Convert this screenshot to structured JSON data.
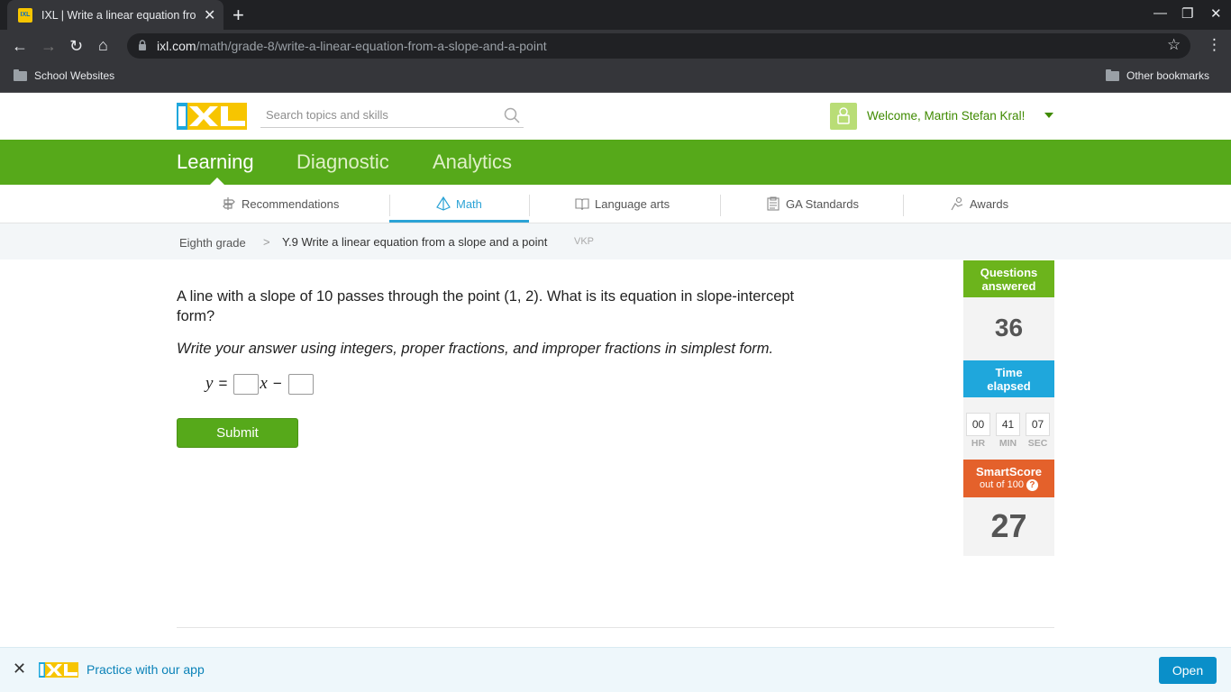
{
  "browser": {
    "tab_title": "IXL | Write a linear equation from",
    "favicon_text": "IXL",
    "url_domain": "ixl.com",
    "url_path": "/math/grade-8/write-a-linear-equation-from-a-slope-and-a-point",
    "bookmarks": {
      "left": "School Websites",
      "right": "Other bookmarks"
    }
  },
  "header": {
    "search_placeholder": "Search topics and skills",
    "welcome": "Welcome, Martin Stefan Kral!"
  },
  "main_nav": {
    "items": [
      "Learning",
      "Diagnostic",
      "Analytics"
    ],
    "active": "Learning"
  },
  "sub_nav": {
    "items": [
      "Recommendations",
      "Math",
      "Language arts",
      "GA Standards",
      "Awards"
    ],
    "active": "Math"
  },
  "breadcrumb": {
    "grade": "Eighth grade",
    "separator": ">",
    "skill": "Y.9 Write a linear equation from a slope and a point",
    "code": "VKP"
  },
  "question": {
    "prompt": "A line with a slope of 10 passes through the point (1, 2). What is its equation in slope-intercept form?",
    "instruction": "Write your answer using integers, proper fractions, and improper fractions in simplest form.",
    "eq_y": "y",
    "eq_equals": "=",
    "eq_x": "x",
    "eq_minus": "−",
    "submit_label": "Submit"
  },
  "stats": {
    "questions_label_1": "Questions",
    "questions_label_2": "answered",
    "questions_answered": "36",
    "time_label_1": "Time",
    "time_label_2": "elapsed",
    "time": {
      "hr": "00",
      "min": "41",
      "sec": "07"
    },
    "time_units": {
      "hr": "HR",
      "min": "MIN",
      "sec": "SEC"
    },
    "smartscore_label": "SmartScore",
    "smartscore_sub": "out of 100",
    "smartscore_help": "?",
    "smartscore": "27"
  },
  "app_banner": {
    "text": "Practice with our app",
    "open_label": "Open"
  },
  "colors": {
    "ixl_green": "#56a91a",
    "ixl_blue": "#2ba3d6",
    "smartscore_orange": "#e4612b",
    "questions_green": "#6cb41c",
    "time_blue": "#1fa7dc"
  }
}
